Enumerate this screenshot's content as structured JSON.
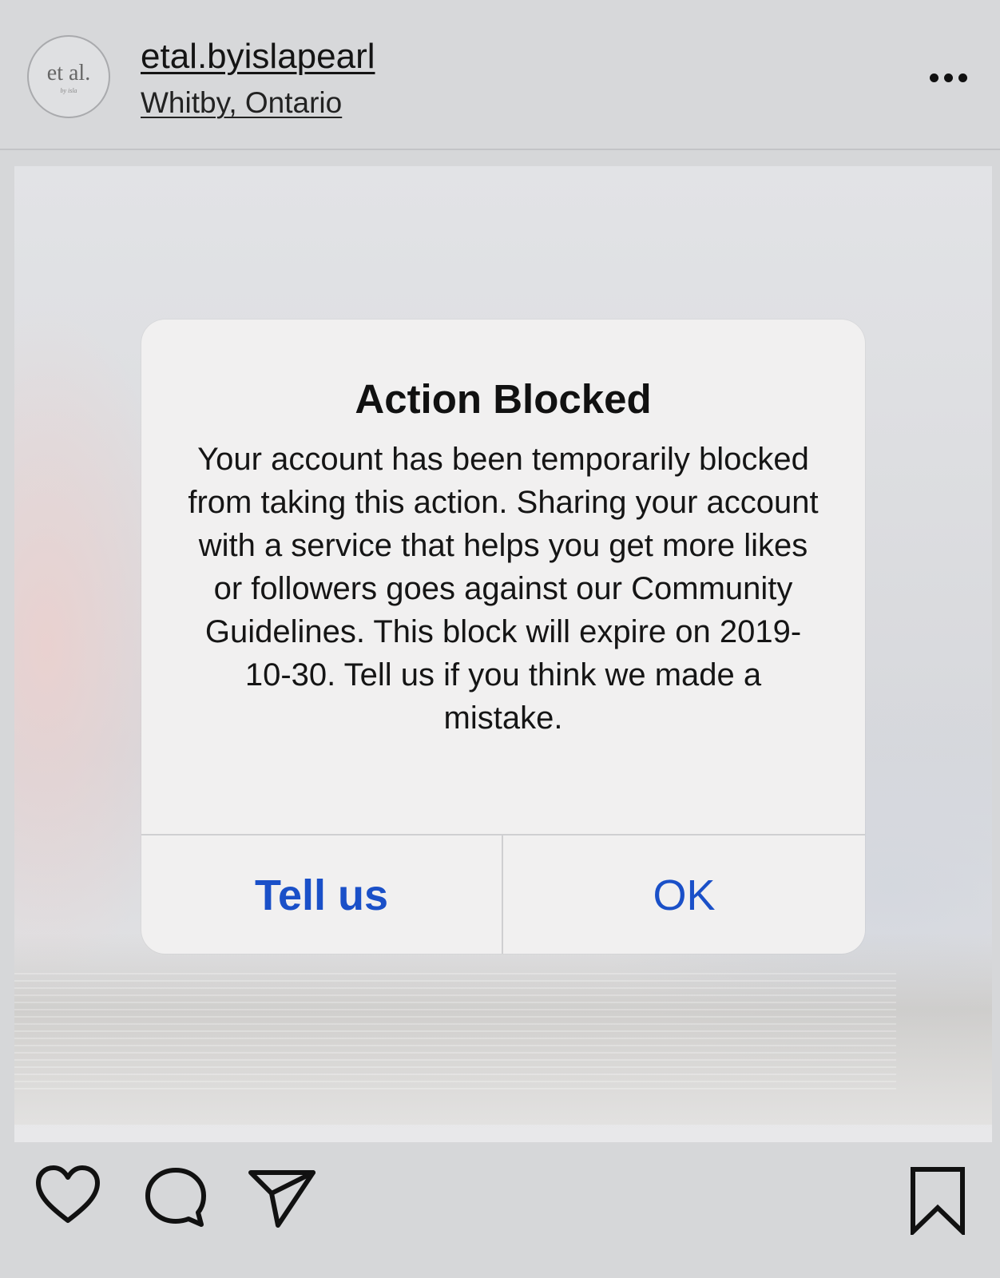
{
  "header": {
    "avatar_text": "et al.",
    "avatar_subtext": "by isla",
    "username": "etal.byislapearl",
    "location": "Whitby, Ontario",
    "more_icon": "more-dots-icon"
  },
  "dialog": {
    "title": "Action Blocked",
    "message": "Your account has been temporarily blocked from taking this action. Sharing your account with a service that helps you get more likes or followers goes against our Community Guidelines. This block will expire on 2019-10-30. Tell us if you think we made a mistake.",
    "buttons": {
      "tell_us": "Tell us",
      "ok": "OK"
    },
    "button_color": "#1a50c8"
  },
  "actions": {
    "like_icon": "heart-icon",
    "comment_icon": "comment-icon",
    "share_icon": "send-icon",
    "save_icon": "bookmark-icon"
  }
}
